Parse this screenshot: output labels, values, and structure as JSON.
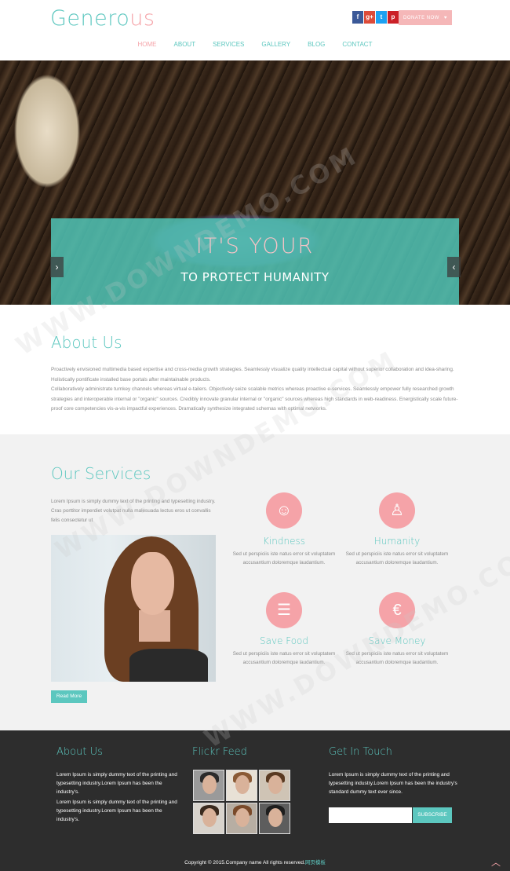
{
  "header": {
    "logo_main": "Genero",
    "logo_accent": "us",
    "social": [
      "f",
      "g+",
      "t",
      "p"
    ],
    "donate_label": "DONATE NOW",
    "donate_icon": "heart-icon"
  },
  "nav": {
    "items": [
      "HOME",
      "ABOUT",
      "SERVICES",
      "GALLERY",
      "BLOG",
      "CONTACT"
    ],
    "active": "HOME"
  },
  "hero": {
    "line1": "IT'S YOUR",
    "line2": "TO PROTECT HUMANITY",
    "prev": "‹",
    "next": "‹"
  },
  "about": {
    "title": "About Us",
    "paragraph1": "Proactively envisioned multimedia based expertise and cross-media growth strategies. Seamlessly visualize quality intellectual capital without superior collaboration and idea-sharing. Holistically pontificate installed base portals after maintainable products.",
    "paragraph2": "Collaboratively administrate turnkey channels whereas virtual e-tailers. Objectively seize scalable metrics whereas proactive e-services. Seamlessly empower fully researched growth strategies and interoperable internal or \"organic\" sources. Credibly innovate granular internal or \"organic\" sources whereas high standards in web-readiness. Energistically scale future-proof core competencies vis-a-vis impactful experiences. Dramatically synthesize integrated schemas with optimal networks."
  },
  "services": {
    "title": "Our Services",
    "intro": "Lorem Ipsum is simply dummy text of the printing and typesetting industry. Cras porttitor imperdiet volutpat nulla malesuada lectus eros ut convallis felis consectetur ut",
    "read_more": "Read More",
    "items": [
      {
        "title": "Kindness",
        "text": "Sed ut perspiciis iste natus error sit voluptatem accusantium doloremque laudantium."
      },
      {
        "title": "Humanity",
        "text": "Sed ut perspiciis iste natus error sit voluptatem accusantium doloremque laudantium."
      },
      {
        "title": "Save Food",
        "text": "Sed ut perspiciis iste natus error sit voluptatem accusantium doloremque laudantium."
      },
      {
        "title": "Save Money",
        "text": "Sed ut perspiciis iste natus error sit voluptatem accusantium doloremque laudantium."
      }
    ]
  },
  "footer": {
    "about_title": "About Us",
    "about_p1": "Lorem Ipsum is simply dummy text of the printing and typesetting industry.Lorem Ipsum has been the industry's.",
    "about_p2": "Lorem Ipsum is simply dummy text of the printing and typesetting industry.Lorem Ipsum has been the industry's.",
    "flickr_title": "Flickr Feed",
    "touch_title": "Get In Touch",
    "touch_text": "Lorem Ipsum is simply dummy text of the printing and typesetting industry.Lorem Ipsum has been the industry's standard dummy text ever since.",
    "subscribe_label": "SUBSCRIBE",
    "copyright": "Copyright © 2015.Company name All rights reserved.",
    "copyright_link": "网页模板",
    "to_top": "︿"
  },
  "watermark": "WWW.DOWNDEMO.COM"
}
